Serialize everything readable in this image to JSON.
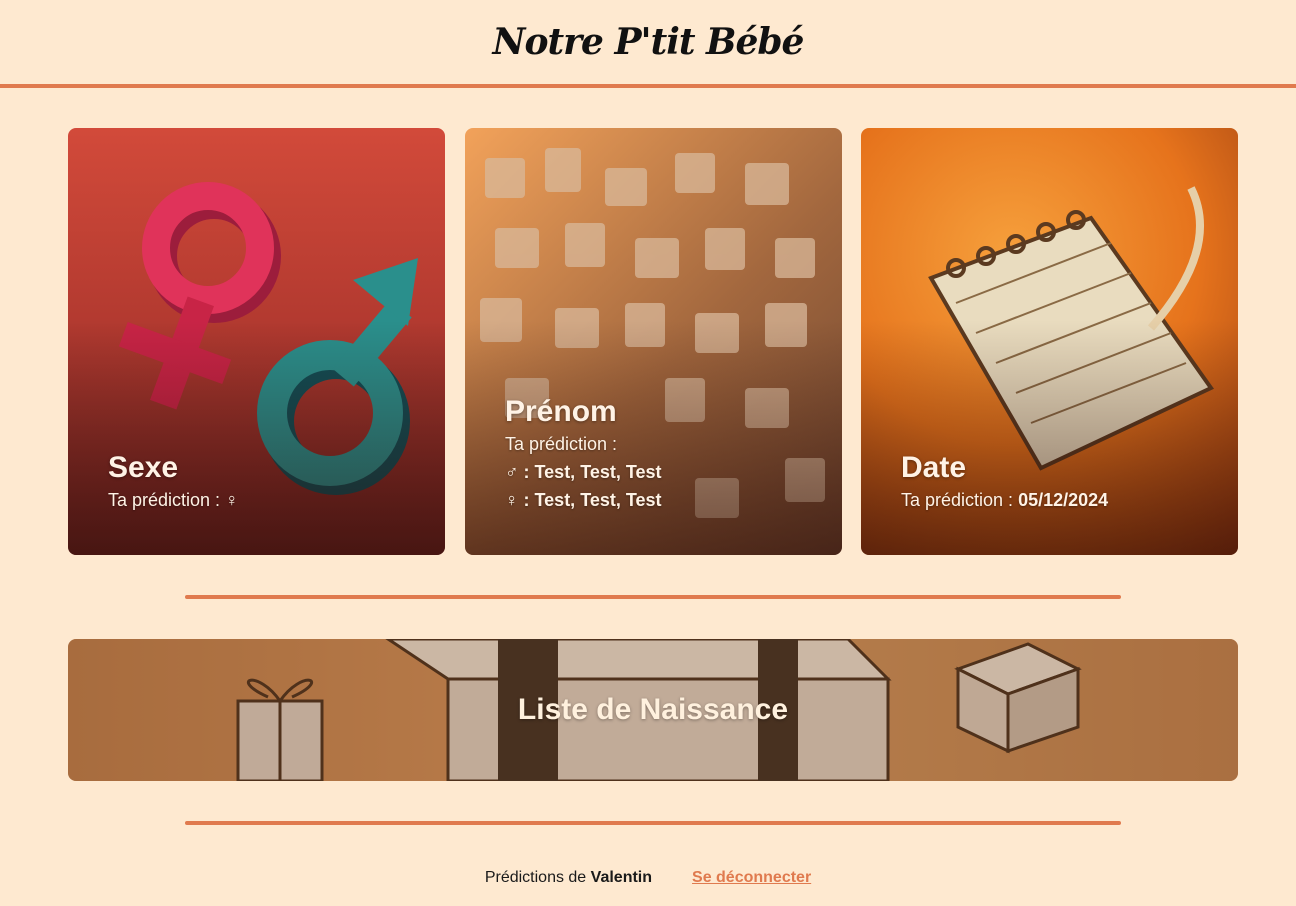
{
  "header": {
    "title": "Notre P'tit Bébé"
  },
  "cards": {
    "sexe": {
      "title": "Sexe",
      "prediction_label": "Ta prédiction :",
      "prediction_value": "♀"
    },
    "prenom": {
      "title": "Prénom",
      "prediction_label": "Ta prédiction :",
      "boy_symbol": "♂",
      "boy_names": ": Test, Test, Test",
      "girl_symbol": "♀",
      "girl_names": ": Test, Test, Test"
    },
    "date": {
      "title": "Date",
      "prediction_label": "Ta prédiction :",
      "prediction_value": "05/12/2024"
    }
  },
  "banner": {
    "title": "Liste de Naissance"
  },
  "footer": {
    "predictions_label": "Prédictions de",
    "user_name": "Valentin",
    "logout_label": "Se déconnecter"
  },
  "colors": {
    "accent": "#e07a4e",
    "background": "#fee9d0"
  }
}
